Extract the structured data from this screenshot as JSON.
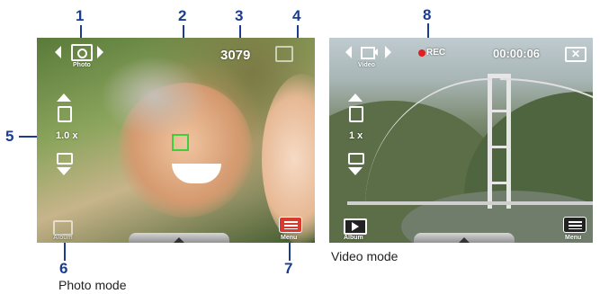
{
  "callouts": {
    "n1": "1",
    "n2": "2",
    "n3": "3",
    "n4": "4",
    "n5": "5",
    "n6": "6",
    "n7": "7",
    "n8": "8"
  },
  "photo_mode": {
    "mode_label": "Photo",
    "shots_remaining": "3079",
    "zoom_level": "1.0 x",
    "album_label": "Album",
    "menu_label": "Menu",
    "caption": "Photo mode"
  },
  "video_mode": {
    "mode_label": "Video",
    "rec_label": "REC",
    "timer": "00:00:06",
    "zoom_level": "1 x",
    "album_label": "Album",
    "menu_label": "Menu",
    "caption": "Video mode"
  },
  "colors": {
    "callout": "#1a3d8f",
    "menu_red": "#d93a2b",
    "rec_red": "#e02020",
    "focus_green": "#3cd13c"
  },
  "icons": [
    "camera-icon",
    "video-camera-icon",
    "zoom-in-icon",
    "zoom-out-icon",
    "close-icon",
    "album-icon",
    "menu-icon",
    "rec-icon",
    "focus-bracket-icon"
  ]
}
